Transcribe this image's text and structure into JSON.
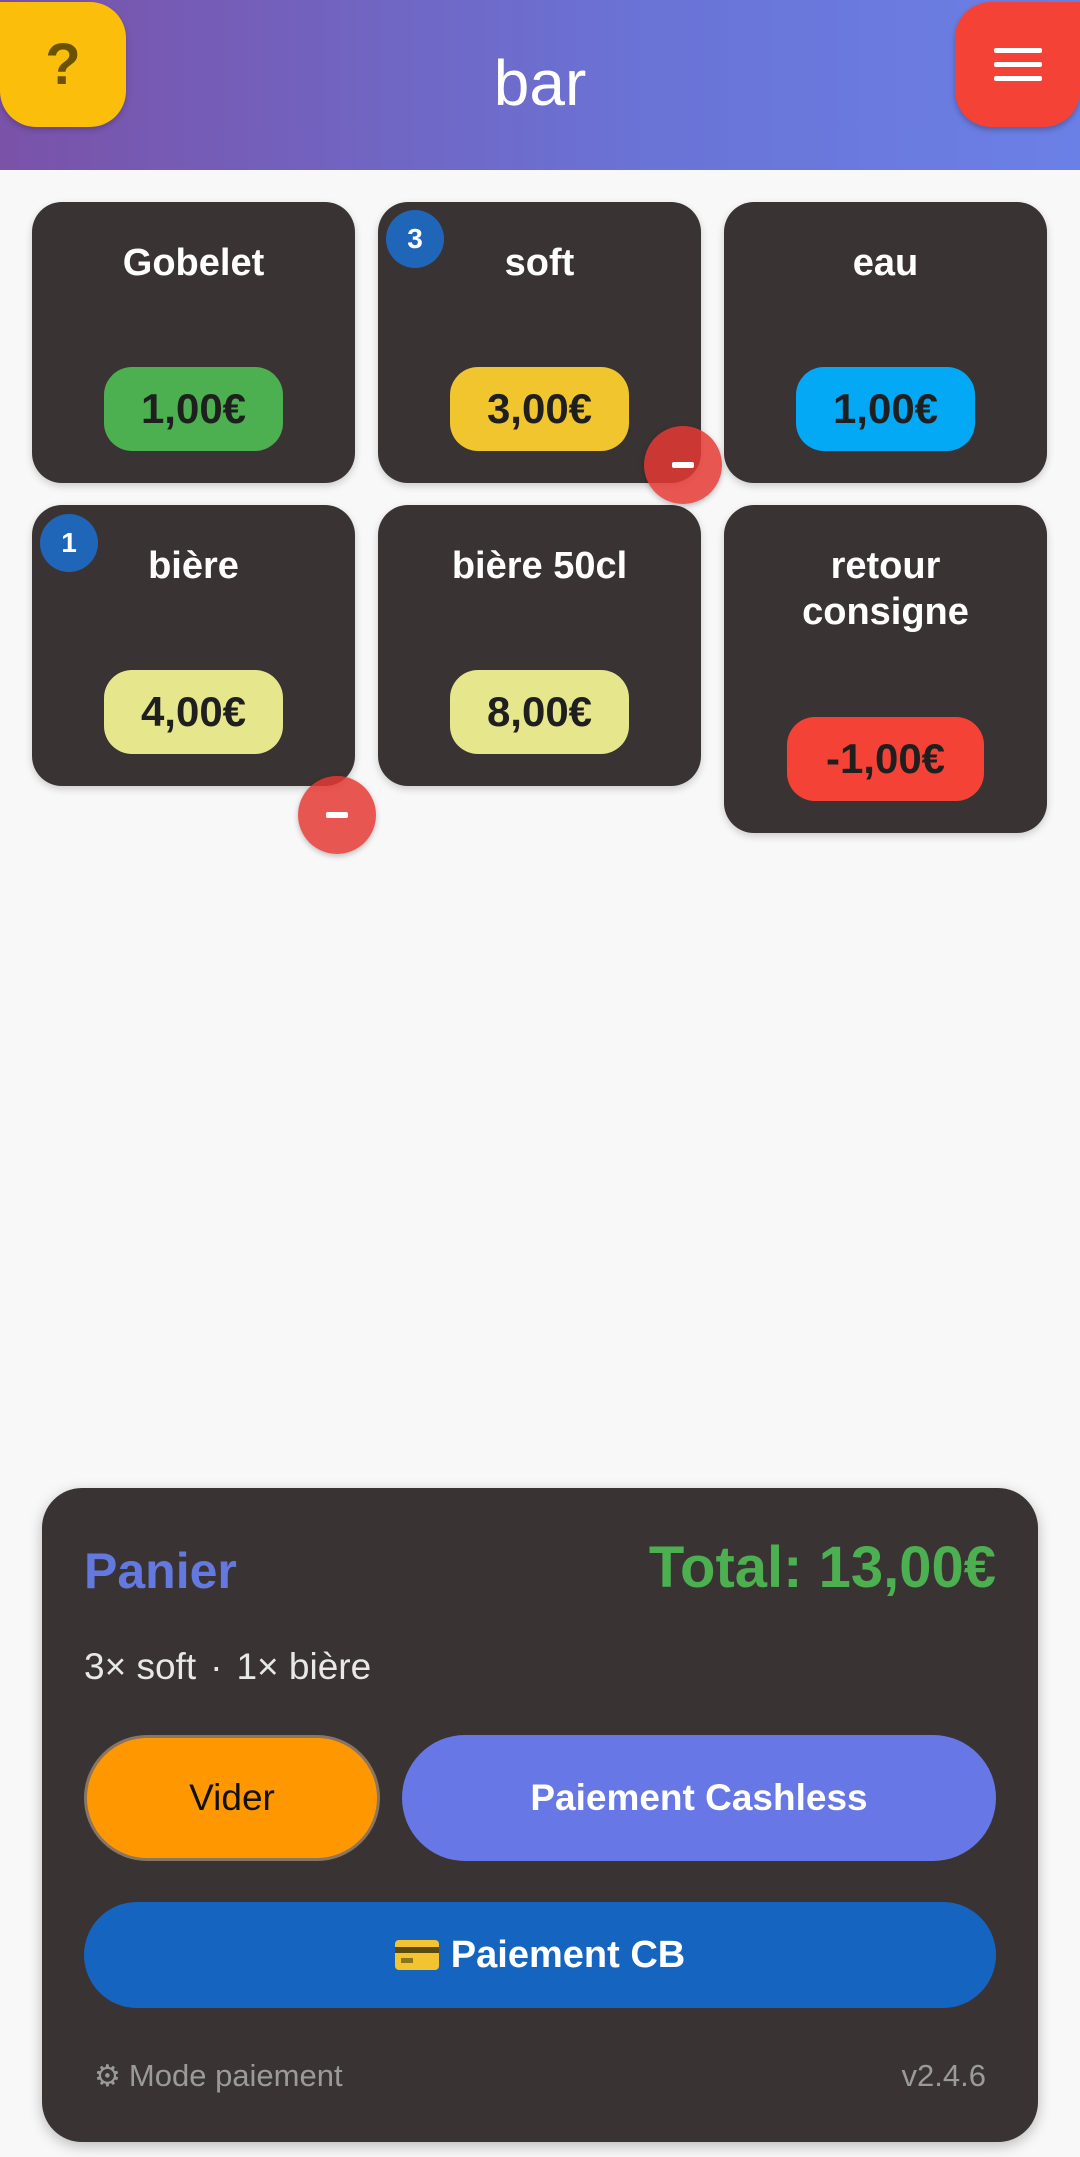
{
  "header": {
    "title": "bar",
    "help_icon": "?",
    "menu_icon": "hamburger-menu-icon",
    "colors": {
      "help": "#fbbe0b",
      "menu": "#f44336"
    }
  },
  "products": [
    {
      "name": "Gobelet",
      "price": "1,00€",
      "price_color": "#4caf50",
      "count": null
    },
    {
      "name": "soft",
      "price": "3,00€",
      "price_color": "#f0c52e",
      "count": "3"
    },
    {
      "name": "eau",
      "price": "1,00€",
      "price_color": "#03a9f4",
      "count": null
    },
    {
      "name": "bière",
      "price": "4,00€",
      "price_color": "#e6e68c",
      "count": "1"
    },
    {
      "name": "bière 50cl",
      "price": "8,00€",
      "price_color": "#e6e68c",
      "count": null
    },
    {
      "name": "retour consigne",
      "price": "-1,00€",
      "price_color": "#f44336",
      "count": null
    }
  ],
  "cart": {
    "title": "Panier",
    "total": "Total: 13,00€",
    "items": [
      "3× soft",
      "1× bière"
    ],
    "separator": "·",
    "clear_label": "Vider",
    "cashless_label": "Paiement Cashless",
    "card_label": "Paiement CB",
    "mode_label": "Mode paiement",
    "version": "v2.4.6"
  }
}
